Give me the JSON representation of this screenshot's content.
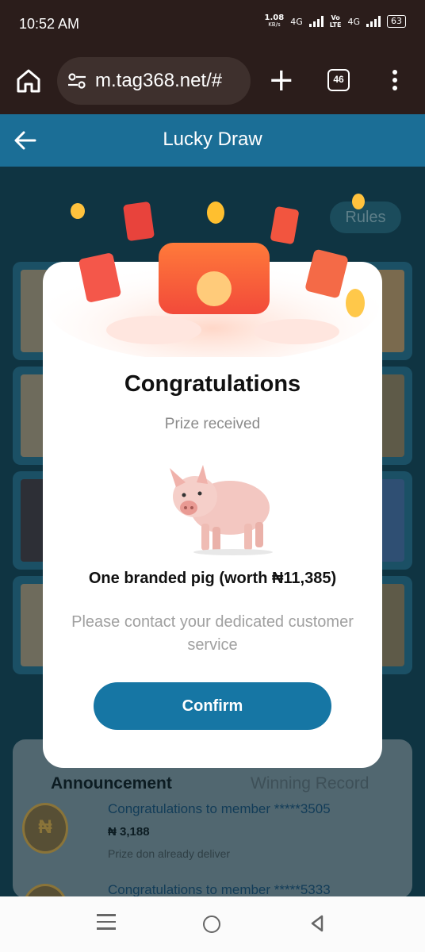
{
  "status_bar": {
    "time": "10:52 AM",
    "net_speed": "1.08",
    "net_unit": "KB/s",
    "net1": "4G",
    "volte": "Vo",
    "volte_sub": "LTE",
    "net2": "4G",
    "battery": "63"
  },
  "browser": {
    "url": "m.tag368.net/#",
    "tab_count": "46"
  },
  "header": {
    "title": "Lucky Draw"
  },
  "background": {
    "rules_label": "Rules",
    "announcement": {
      "tab_announcement": "Announcement",
      "tab_winning_record": "Winning Record",
      "rows": [
        {
          "coin": "₦",
          "message": "Congratulations to member *****3505",
          "amount": "₦ 3,188",
          "note": "Prize don already deliver"
        },
        {
          "coin": "₦",
          "message": "Congratulations to member *****5333",
          "amount": "",
          "note": ""
        }
      ]
    }
  },
  "modal": {
    "title": "Congratulations",
    "subtitle": "Prize received",
    "prize_image": "pig-icon",
    "prize_text": "One branded pig (worth ₦11,385)",
    "contact_text": "Please contact your dedicated customer service",
    "confirm_label": "Confirm"
  },
  "colors": {
    "accent": "#1676a4",
    "header": "#1b6e96",
    "chrome": "#2b1d1b"
  }
}
